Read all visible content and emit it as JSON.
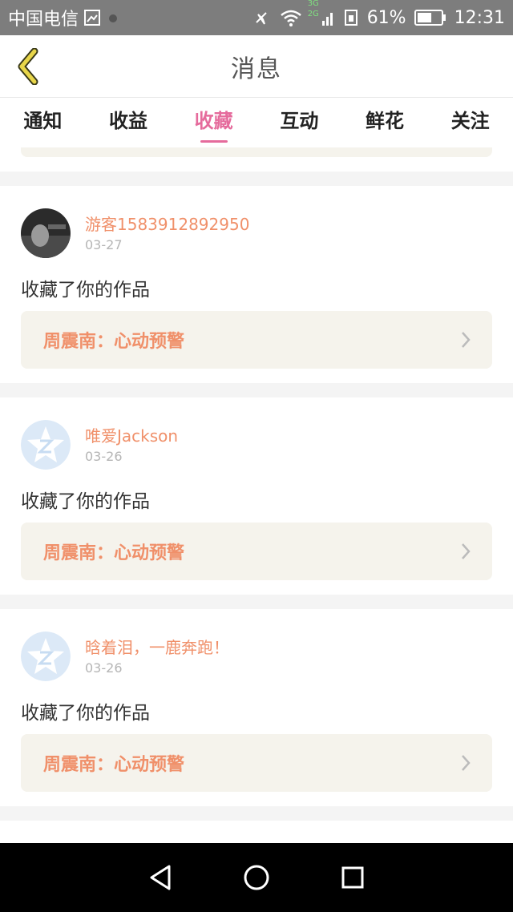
{
  "status_bar": {
    "carrier": "中国电信",
    "battery_percent": "61%",
    "time": "12:31",
    "net_3g": "3G",
    "net_2g": "2G",
    "battery_level": 0.61
  },
  "header": {
    "title": "消息"
  },
  "tabs": [
    {
      "label": "通知",
      "active": false
    },
    {
      "label": "收益",
      "active": false
    },
    {
      "label": "收藏",
      "active": true
    },
    {
      "label": "互动",
      "active": false
    },
    {
      "label": "鲜花",
      "active": false
    },
    {
      "label": "关注",
      "active": false
    }
  ],
  "items": [
    {
      "user": "游客1583912892950",
      "date": "03-27",
      "action": "收藏了你的作品",
      "work": "周震南：心动预警",
      "avatar": "photo-avatar"
    },
    {
      "user": "唯爱Jackson",
      "date": "03-26",
      "action": "收藏了你的作品",
      "work": "周震南：心动预警",
      "avatar": "default-star-avatar"
    },
    {
      "user": "晗着泪，一鹿奔跑！",
      "date": "03-26",
      "action": "收藏了你的作品",
      "work": "周震南：心动预警",
      "avatar": "default-star-avatar"
    }
  ],
  "colors": {
    "accent": "#e56b9c",
    "username": "#f0906a",
    "work_box": "#f5f3ec"
  }
}
